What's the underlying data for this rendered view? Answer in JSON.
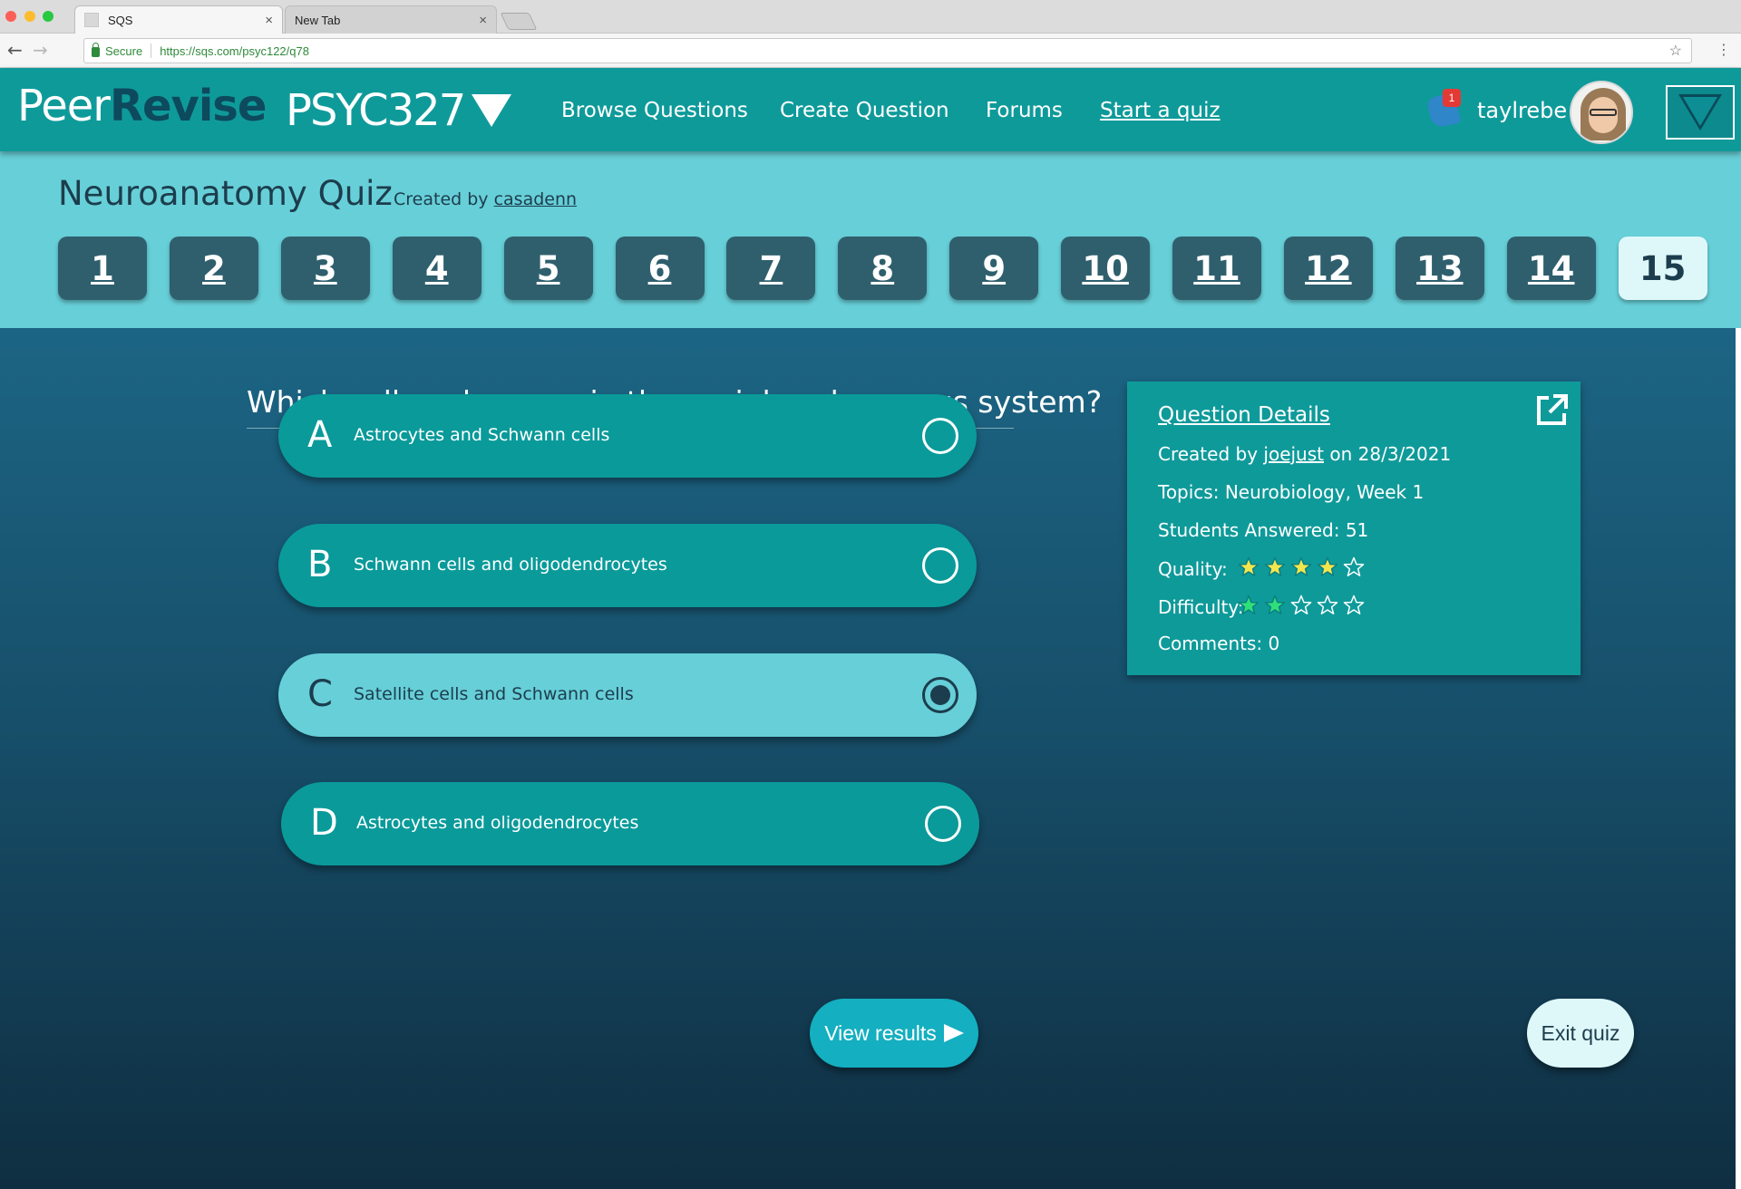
{
  "browser": {
    "tabs": [
      {
        "title": "SQS",
        "close": "×"
      },
      {
        "title": "New Tab",
        "close": "×"
      }
    ],
    "secure_label": "Secure",
    "url": "https://sqs.com/psyc122/q78"
  },
  "header": {
    "logo_part1": "Peer",
    "logo_part2": "Revise",
    "course": "PSYC327",
    "nav": [
      "Browse Questions",
      "Create Question",
      "Forums",
      "Start a quiz"
    ],
    "notification_count": "1",
    "username": "taylrebe"
  },
  "quiz": {
    "title": "Neuroanatomy Quiz",
    "created_by_label": "Created by",
    "creator": "casadenn",
    "question_numbers": [
      "1",
      "2",
      "3",
      "4",
      "5",
      "6",
      "7",
      "8",
      "9",
      "10",
      "11",
      "12",
      "13",
      "14",
      "15"
    ],
    "current_question": "15"
  },
  "question": {
    "text": "Which cells only occur in the peripheral nervous system?",
    "options": [
      {
        "letter": "A",
        "label": "Astrocytes and Schwann cells",
        "selected": false
      },
      {
        "letter": "B",
        "label": "Schwann cells and oligodendrocytes",
        "selected": false
      },
      {
        "letter": "C",
        "label": "Satellite cells and Schwann cells",
        "selected": true
      },
      {
        "letter": "D",
        "label": "Astrocytes and oligodendrocytes",
        "selected": false
      }
    ]
  },
  "details": {
    "heading": "Question Details",
    "created_by_label": "Created by",
    "author": "joejust",
    "date_text": "on 28/3/2021",
    "topics": "Topics: Neurobiology, Week 1",
    "students_answered": "Students Answered: 51",
    "quality_label": "Quality:",
    "quality_rating": 4,
    "difficulty_label": "Difficulty:",
    "difficulty_rating": 2,
    "rating_max": 5,
    "comments": "Comments: 0",
    "colors": {
      "quality_star": "#f3e64d",
      "difficulty_star": "#2fe07a",
      "empty_star": "#ffffff"
    }
  },
  "actions": {
    "view_results": "View results",
    "exit_quiz": "Exit quiz"
  }
}
